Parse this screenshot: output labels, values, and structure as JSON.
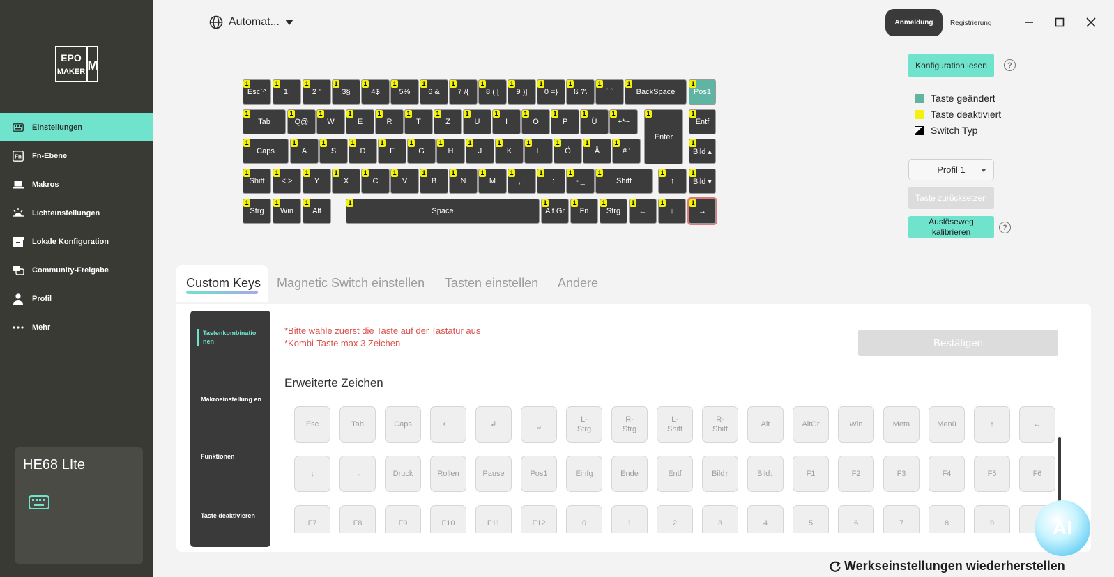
{
  "sidebar": {
    "logo_text": "EPOMAKER",
    "items": [
      {
        "label": "Einstellungen",
        "icon": "keyboard-icon",
        "active": true
      },
      {
        "label": "Fn-Ebene",
        "icon": "fn-icon",
        "active": false
      },
      {
        "label": "Makros",
        "icon": "laptop-icon",
        "active": false
      },
      {
        "label": "Lichteinstellungen",
        "icon": "light-icon",
        "active": false
      },
      {
        "label": "Lokale Konfiguration",
        "icon": "box-icon",
        "active": false
      },
      {
        "label": "Community-Freigabe",
        "icon": "chat-icon",
        "active": false
      },
      {
        "label": "Profil",
        "icon": "user-icon",
        "active": false
      },
      {
        "label": "Mehr",
        "icon": "more-icon",
        "active": false
      }
    ],
    "device_name": "HE68 LIte"
  },
  "topbar": {
    "language": "Automat...",
    "login": "Anmeldung",
    "register": "Registrierung"
  },
  "keyboard": {
    "badge": "1",
    "rows": [
      [
        [
          "Esc`^",
          0,
          41
        ],
        [
          "1!",
          43,
          41
        ],
        [
          "2 ''",
          86,
          41
        ],
        [
          "3§",
          128,
          41
        ],
        [
          "4$",
          170,
          41
        ],
        [
          "5%",
          212,
          41
        ],
        [
          "6 &",
          254,
          41
        ],
        [
          "7 /{",
          296,
          41
        ],
        [
          "8 ( [",
          338,
          41
        ],
        [
          "9 )]",
          380,
          41
        ],
        [
          "0 =}",
          422,
          41
        ],
        [
          "ß ?\\",
          464,
          41
        ],
        [
          "´ `",
          506,
          41
        ],
        [
          "BackSpace",
          548,
          89
        ],
        [
          "Pos1",
          640,
          39
        ]
      ],
      [
        [
          "Tab",
          0,
          62
        ],
        [
          "Q@",
          64,
          41
        ],
        [
          "W",
          106,
          41
        ],
        [
          "E",
          148,
          41
        ],
        [
          "R",
          190,
          41
        ],
        [
          "T",
          232,
          41
        ],
        [
          "Z",
          274,
          41
        ],
        [
          "U",
          316,
          41
        ],
        [
          "I",
          358,
          41
        ],
        [
          "O",
          400,
          41
        ],
        [
          "P",
          442,
          41
        ],
        [
          "Ü",
          484,
          41
        ],
        [
          "+*~",
          526,
          41
        ],
        [
          "Entf",
          640,
          39
        ]
      ],
      [
        [
          "Caps",
          0,
          66
        ],
        [
          "A",
          68,
          41
        ],
        [
          "S",
          110,
          41
        ],
        [
          "D",
          152,
          41
        ],
        [
          "F",
          194,
          41
        ],
        [
          "G",
          236,
          41
        ],
        [
          "H",
          278,
          41
        ],
        [
          "J",
          320,
          41
        ],
        [
          "K",
          362,
          41
        ],
        [
          "L",
          404,
          41
        ],
        [
          "Ö",
          446,
          41
        ],
        [
          "Ä",
          488,
          41
        ],
        [
          "#  '",
          530,
          41
        ],
        [
          "Bild ▴",
          640,
          39
        ]
      ],
      [
        [
          "Shift",
          0,
          41
        ],
        [
          "<  >",
          43,
          41
        ],
        [
          "Y",
          86,
          41
        ],
        [
          "X",
          128,
          41
        ],
        [
          "C",
          170,
          41
        ],
        [
          "V",
          212,
          41
        ],
        [
          "B",
          254,
          41
        ],
        [
          "N",
          296,
          41
        ],
        [
          "M",
          338,
          41
        ],
        [
          ", ;",
          380,
          41
        ],
        [
          ". :",
          422,
          41
        ],
        [
          "- _",
          464,
          41
        ],
        [
          "Shift",
          506,
          82
        ],
        [
          "↑",
          596,
          41
        ],
        [
          "Bild ▾",
          640,
          39
        ]
      ],
      [
        [
          "Strg",
          0,
          41
        ],
        [
          "Win",
          43,
          41
        ],
        [
          "Alt",
          86,
          41
        ],
        [
          "Space",
          148,
          278
        ],
        [
          "Alt Gr",
          428,
          40
        ],
        [
          "Fn",
          470,
          40
        ],
        [
          "Strg",
          512,
          40
        ],
        [
          "←",
          554,
          40
        ],
        [
          "↓",
          596,
          40
        ],
        [
          "→",
          640,
          39
        ]
      ]
    ],
    "enter_label": "Enter"
  },
  "right_panel": {
    "read_config": "Konfiguration lesen",
    "legend": [
      {
        "label": "Taste geändert",
        "color": "#5fb5a1"
      },
      {
        "label": "Taste deaktiviert",
        "color": "#f2f20c"
      },
      {
        "label": "Switch Typ",
        "color": "#000000"
      }
    ],
    "profile": "Profil 1",
    "reset_key": "Taste zurücksetzen",
    "calibrate": "Auslöseweg kalibrieren"
  },
  "tabs": [
    "Custom Keys",
    "Magnetic Switch einstellen",
    "Tasten einstellen",
    "Andere"
  ],
  "subnav": [
    "Tastenkombinatio nen",
    "Makroeinstellung en",
    "Funktionen",
    "Taste deaktivieren"
  ],
  "warnings": [
    "*Bitte wähle zuerst die Taste auf der Tastatur aus",
    "*Kombi-Taste max 3 Zeichen"
  ],
  "confirm": "Bestätigen",
  "section_title": "Erweiterte Zeichen",
  "extended_keys": [
    [
      "Esc",
      "Tab",
      "Caps",
      "⟵",
      "↲",
      "␣",
      "L-\nStrg",
      "R-\nStrg",
      "L-\nShift",
      "R-\nShift",
      "Alt",
      "AltGr",
      "Win",
      "Meta",
      "Menü",
      "↑",
      "←"
    ],
    [
      "↓",
      "→",
      "Druck",
      "Rollen",
      "Pause",
      "Pos1",
      "Einfg",
      "Ende",
      "Entf",
      "Bild↑",
      "Bild↓",
      "F1",
      "F2",
      "F3",
      "F4",
      "F5",
      "F6"
    ],
    [
      "F7",
      "F8",
      "F9",
      "F10",
      "F11",
      "F12",
      "0",
      "1",
      "2",
      "3",
      "4",
      "5",
      "6",
      "7",
      "8",
      "9",
      "A"
    ]
  ],
  "factory_reset": "Werkseinstellungen wiederherstellen",
  "ai_label": "AI"
}
